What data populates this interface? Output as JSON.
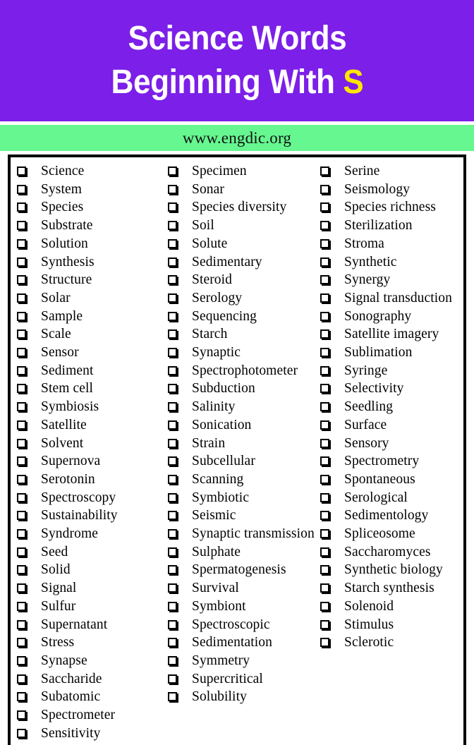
{
  "header": {
    "title_line_1": "Science Words",
    "title_line_2_prefix": "Beginning With ",
    "title_line_2_accent": "S",
    "background_color": "#7C1FE8",
    "text_color": "#FFFFFF",
    "accent_color": "#FFE600"
  },
  "urlbar": {
    "text": "www.engdic.org",
    "background_color": "#66F790",
    "text_color": "#111111"
  },
  "list": {
    "checkbox_glyph": "empty-square-checkbox",
    "border_color": "#000000",
    "columns": [
      {
        "name": "column-1",
        "words": [
          "Science",
          "System",
          "Species",
          "Substrate",
          "Solution",
          "Synthesis",
          "Structure",
          "Solar",
          "Sample",
          "Scale",
          "Sensor",
          "Sediment",
          "Stem cell",
          "Symbiosis",
          "Satellite",
          "Solvent",
          "Supernova",
          "Serotonin",
          "Spectroscopy",
          "Sustainability",
          "Syndrome",
          "Seed",
          "Solid",
          "Signal",
          "Sulfur",
          "Supernatant",
          "Stress",
          "Synapse",
          "Saccharide",
          "Subatomic",
          "Spectrometer",
          "Sensitivity"
        ]
      },
      {
        "name": "column-2",
        "words": [
          "Specimen",
          "Sonar",
          "Species diversity",
          "Soil",
          "Solute",
          "Sedimentary",
          "Steroid",
          "Serology",
          "Sequencing",
          "Starch",
          "Synaptic",
          "Spectrophotometer",
          "Subduction",
          "Salinity",
          "Sonication",
          "Strain",
          "Subcellular",
          "Scanning",
          "Symbiotic",
          "Seismic",
          "Synaptic transmission",
          "Sulphate",
          "Spermatogenesis",
          "Survival",
          "Symbiont",
          "Spectroscopic",
          "Sedimentation",
          "Symmetry",
          "Supercritical",
          "Solubility"
        ]
      },
      {
        "name": "column-3",
        "words": [
          "Serine",
          "Seismology",
          "Species richness",
          "Sterilization",
          "Stroma",
          "Synthetic",
          "Synergy",
          "Signal transduction",
          "Sonography",
          "Satellite imagery",
          "Sublimation",
          "Syringe",
          "Selectivity",
          "Seedling",
          "Surface",
          "Sensory",
          "Spectrometry",
          "Spontaneous",
          "Serological",
          "Sedimentology",
          "Spliceosome",
          "Saccharomyces",
          "Synthetic biology",
          "Starch synthesis",
          "Solenoid",
          "Stimulus",
          "Sclerotic"
        ]
      }
    ]
  }
}
